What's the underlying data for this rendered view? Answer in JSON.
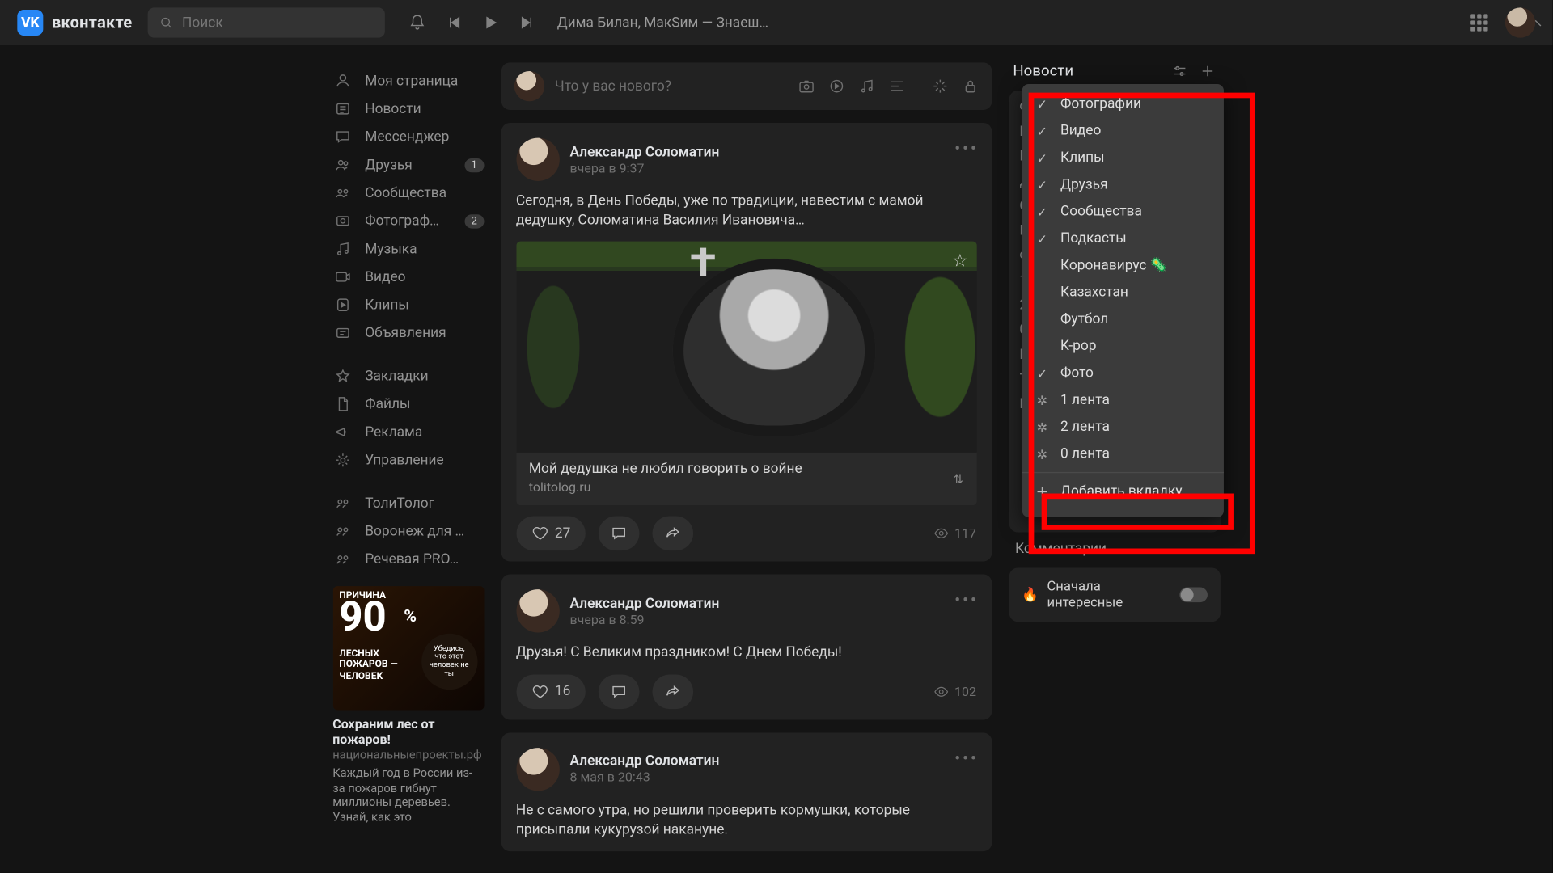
{
  "header": {
    "brand": "вконтакте",
    "search_placeholder": "Поиск",
    "now_playing": "Дима Билан, МакSим — Знаеш…"
  },
  "sidebar": {
    "items": [
      {
        "label": "Моя страница",
        "icon": "user"
      },
      {
        "label": "Новости",
        "icon": "news"
      },
      {
        "label": "Мессенджер",
        "icon": "msg"
      },
      {
        "label": "Друзья",
        "icon": "friends",
        "badge": "1"
      },
      {
        "label": "Сообщества",
        "icon": "groups"
      },
      {
        "label": "Фотограф…",
        "icon": "photo",
        "badge": "2"
      },
      {
        "label": "Музыка",
        "icon": "music"
      },
      {
        "label": "Видео",
        "icon": "video"
      },
      {
        "label": "Клипы",
        "icon": "clips"
      },
      {
        "label": "Объявления",
        "icon": "ads"
      }
    ],
    "items2": [
      {
        "label": "Закладки",
        "icon": "star"
      },
      {
        "label": "Файлы",
        "icon": "file"
      },
      {
        "label": "Реклама",
        "icon": "promo"
      },
      {
        "label": "Управление",
        "icon": "gear"
      }
    ],
    "items3": [
      {
        "label": "ТолиТолог",
        "icon": "grp"
      },
      {
        "label": "Воронеж для …",
        "icon": "grp"
      },
      {
        "label": "Речевая PRO…",
        "icon": "grp"
      }
    ],
    "ad": {
      "big": "90",
      "pct": "%",
      "top_word": "ПРИЧИНА",
      "lines": "ЛЕСНЫХ\nПОЖАРОВ —\nЧЕЛОВЕК",
      "bubble": "Убедись, что этот человек не ты",
      "title": "Сохраним лес от пожаров!",
      "domain": "национальныепроекты.рф",
      "text": "Каждый год в России из-за пожаров гибнут миллионы деревьев. Узнай, как это"
    }
  },
  "composer": {
    "placeholder": "Что у вас нового?"
  },
  "posts": [
    {
      "author": "Александр Соломатин",
      "time": "вчера в 9:37",
      "text": "Сегодня, в День Победы, уже по традиции, навестим с мамой дедушку, Соломатина Василия Ивановича…",
      "link_title": "Мой дедушка не любил говорить о войне",
      "link_domain": "tolitolog.ru",
      "likes": "27",
      "views": "117",
      "has_image": true
    },
    {
      "author": "Александр Соломатин",
      "time": "вчера в 8:59",
      "text": "Друзья! С Великим праздником! С Днем Победы!",
      "likes": "16",
      "views": "102",
      "has_image": false
    },
    {
      "author": "Александр Соломатин",
      "time": "8 мая в 20:43",
      "text": "Не с самого утра, но решили проверить кормушки, которые присыпали кукурузой накануне.",
      "likes": "",
      "views": "",
      "has_image": false
    }
  ],
  "aside": {
    "title": "Новости",
    "filter_rows": [
      "Ф…",
      "В…",
      "К…",
      "Д…",
      "С…",
      "П…",
      "Ф…",
      "1…",
      "2…",
      "0…",
      "Ре…",
      "Те…",
      "Ре…"
    ],
    "dropdown": [
      {
        "label": "Фотографии",
        "check": true
      },
      {
        "label": "Видео",
        "check": true
      },
      {
        "label": "Клипы",
        "check": true
      },
      {
        "label": "Друзья",
        "check": true
      },
      {
        "label": "Сообщества",
        "check": true
      },
      {
        "label": "Подкасты",
        "check": true
      },
      {
        "label": "Коронавирус 🦠",
        "check": false
      },
      {
        "label": "Казахстан",
        "check": false
      },
      {
        "label": "Футбол",
        "check": false
      },
      {
        "label": "K-pop",
        "check": false
      },
      {
        "label": "Фото",
        "check": true
      },
      {
        "label": "1 лента",
        "gear": true
      },
      {
        "label": "2 лента",
        "gear": true
      },
      {
        "label": "0 лента",
        "gear": true
      }
    ],
    "add_tab": "Добавить вкладку",
    "comments_peek": "Комментарии",
    "priority": "Сначала интересные"
  }
}
